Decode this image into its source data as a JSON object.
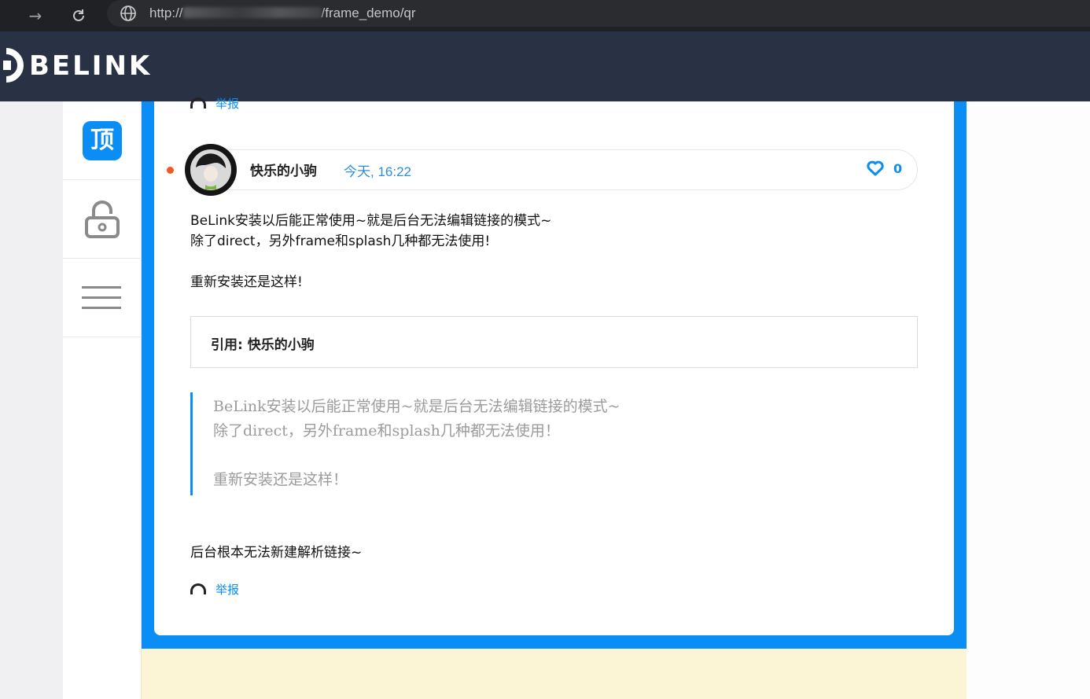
{
  "browser": {
    "url_prefix": "http://",
    "url_suffix": "/frame_demo/qr"
  },
  "site": {
    "logo_text": "BELINK"
  },
  "rail": {
    "top_label": "顶",
    "items": [
      "top-icon",
      "lock-icon",
      "menu-icon"
    ]
  },
  "prev_post": {
    "report_label": "举报"
  },
  "post": {
    "author": "快乐的小驹",
    "time": "今天, 16:22",
    "likes": "0",
    "body_lines": [
      "BeLink安装以后能正常使用~就是后台无法编辑链接的模式~",
      "除了direct，另外frame和splash几种都无法使用!",
      "重新安装还是这样!"
    ],
    "quote_title": "引用: 快乐的小驹",
    "quote_lines": [
      "BeLink安装以后能正常使用~就是后台无法编辑链接的模式~",
      "除了direct，另外frame和splash几种都无法使用！",
      "重新安装还是这样！"
    ],
    "tail": "后台根本无法新建解析链接~",
    "report_label": "举报"
  },
  "colors": {
    "header": "#293244",
    "accent": "#0a8ef5",
    "unread_dot": "#f05a22",
    "cream": "#fbf5d6"
  }
}
